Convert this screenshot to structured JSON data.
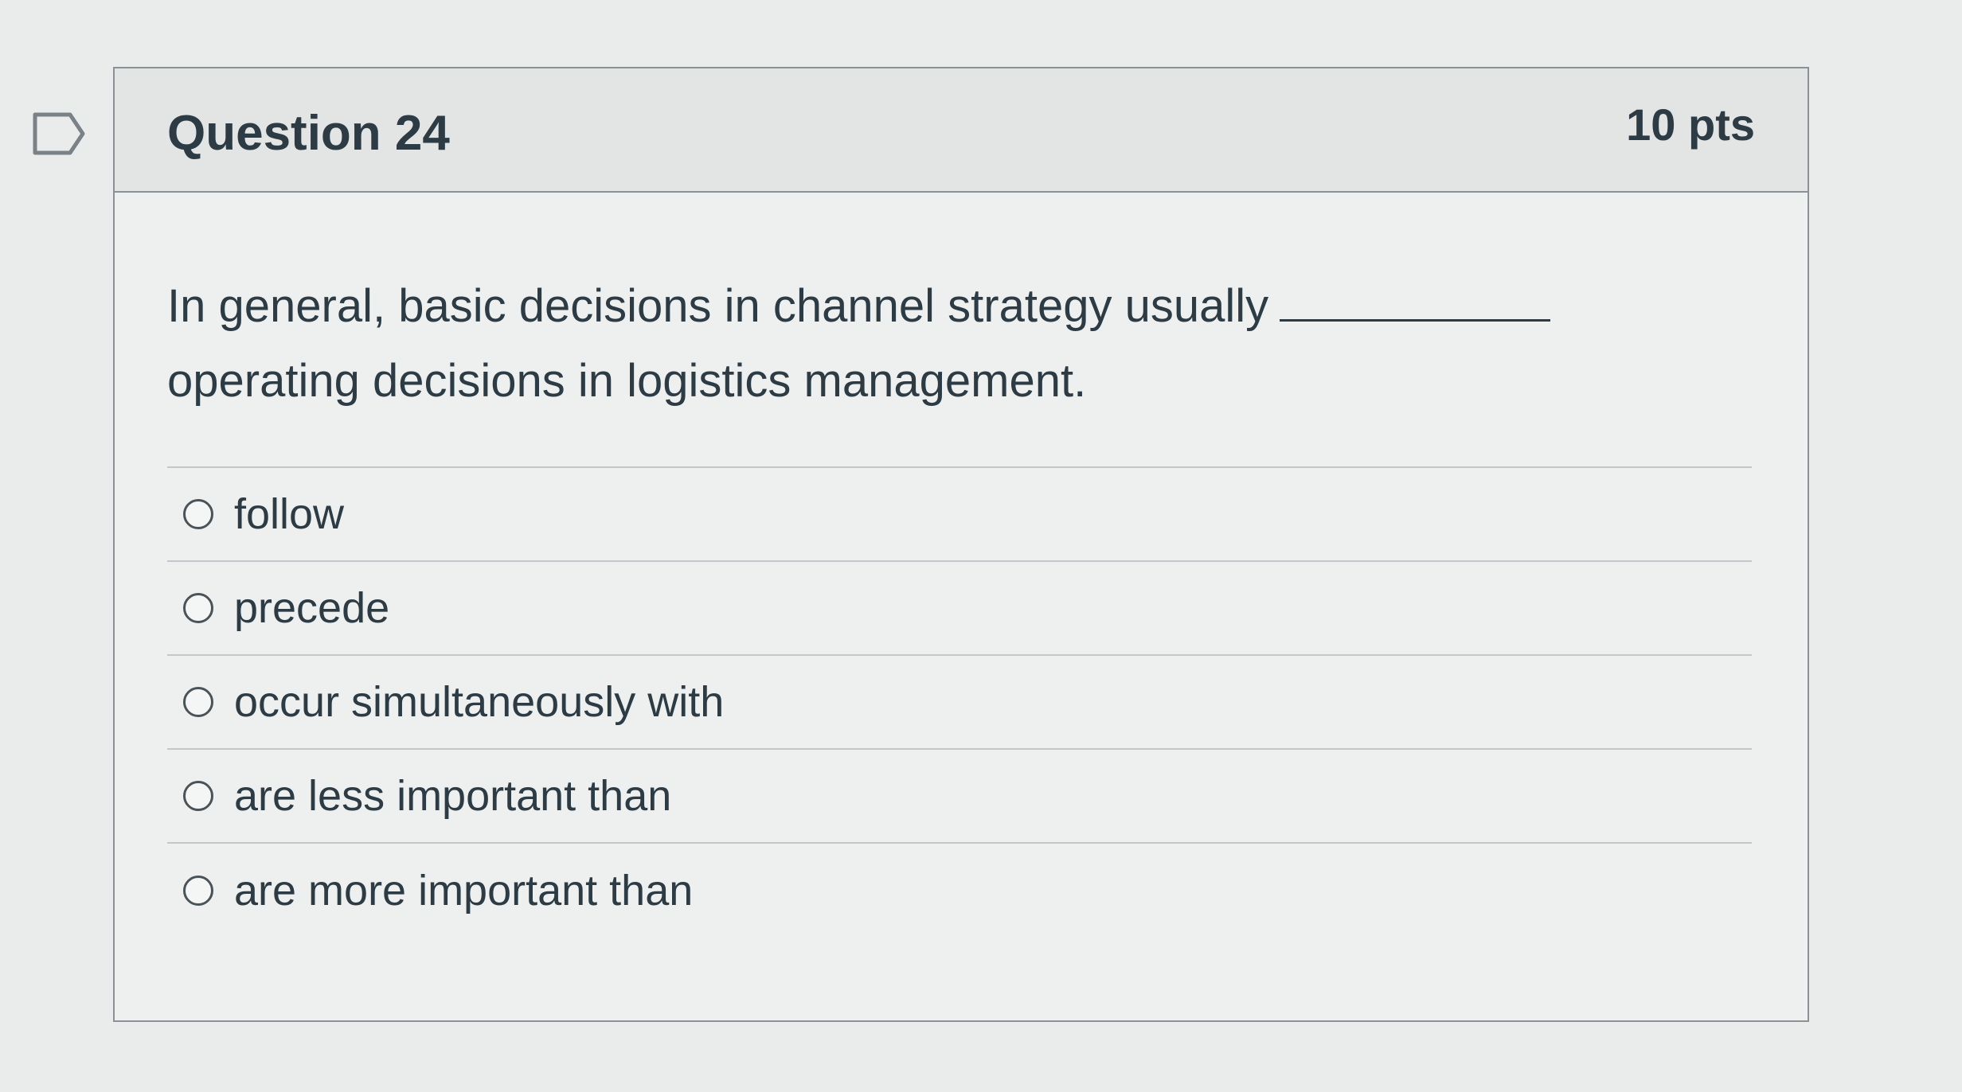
{
  "question": {
    "title": "Question 24",
    "points": "10 pts",
    "text_before_blank": "In general, basic decisions in channel strategy usually",
    "text_after_blank": "operating decisions in logistics management."
  },
  "answers": [
    {
      "label": "follow",
      "selected": false
    },
    {
      "label": "precede",
      "selected": false
    },
    {
      "label": "occur simultaneously with",
      "selected": false
    },
    {
      "label": "are less important than",
      "selected": false
    },
    {
      "label": "are more important than",
      "selected": false
    }
  ],
  "icons": {
    "flag": "bookmark-flag-icon",
    "radio": "radio-unchecked-icon"
  },
  "colors": {
    "text": "#2d3b45",
    "border": "#8c9196",
    "header_bg": "#e2e5e3"
  }
}
